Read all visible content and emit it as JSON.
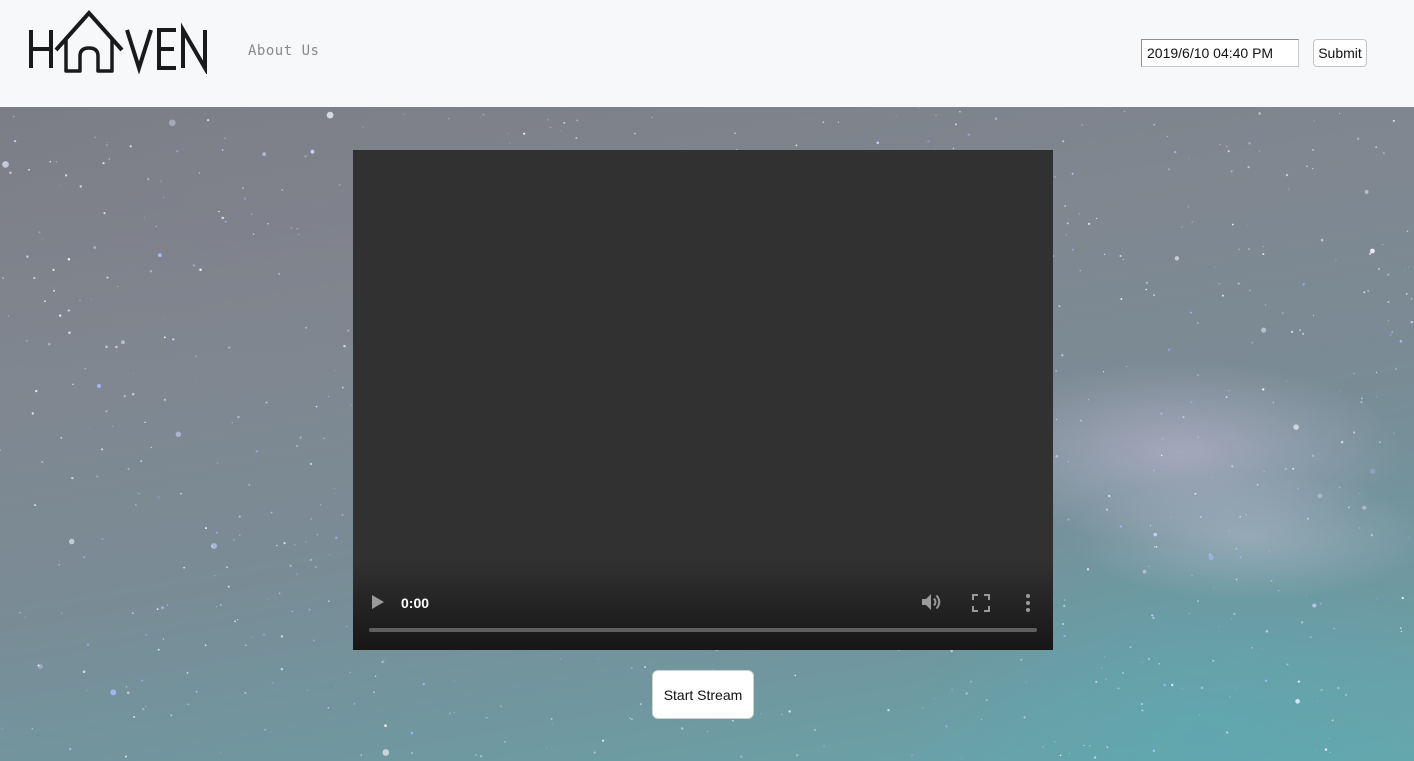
{
  "header": {
    "logo_text": "HAVEN",
    "nav": {
      "about_label": "About Us"
    },
    "datetime_input": {
      "value": "2019/6/10 04:40 PM"
    },
    "submit_label": "Submit"
  },
  "video": {
    "current_time": "0:00",
    "progress": 0,
    "controls": [
      "play-icon",
      "volume-icon",
      "fullscreen-icon",
      "more-options-icon"
    ]
  },
  "main": {
    "start_stream_label": "Start Stream"
  },
  "colors": {
    "header_bg": "#f7f8fa",
    "logo": "#1a1a1a",
    "nav_text": "#8a8a8a",
    "video_bg": "#313131"
  }
}
